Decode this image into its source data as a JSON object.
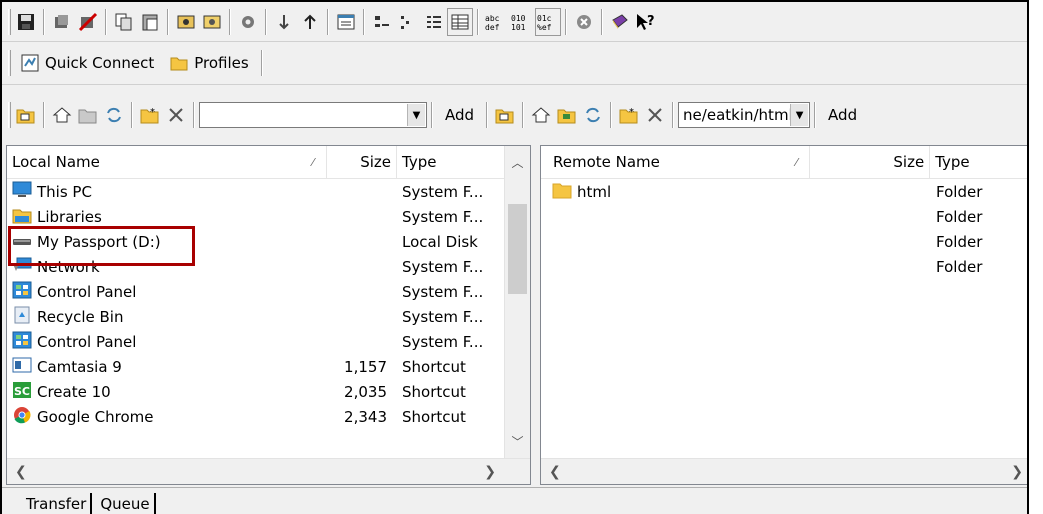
{
  "toolbar2": {
    "quick_connect_label": "Quick Connect",
    "profiles_label": "Profiles"
  },
  "local_bar": {
    "path_value": "",
    "add_label": "Add"
  },
  "remote_bar": {
    "path_value": "ne/eatkin/html",
    "add_label": "Add"
  },
  "local": {
    "headers": {
      "name": "Local Name",
      "size": "Size",
      "type": "Type"
    },
    "rows": [
      {
        "name": "This PC",
        "size": "",
        "type": "System F...",
        "icon": "pc-icon"
      },
      {
        "name": "Libraries",
        "size": "",
        "type": "System F...",
        "icon": "libraries-icon"
      },
      {
        "name": "My Passport (D:)",
        "size": "",
        "type": "Local Disk",
        "icon": "drive-icon"
      },
      {
        "name": "Network",
        "size": "",
        "type": "System F...",
        "icon": "network-icon"
      },
      {
        "name": "Control Panel",
        "size": "",
        "type": "System F...",
        "icon": "control-panel-icon"
      },
      {
        "name": "Recycle Bin",
        "size": "",
        "type": "System F...",
        "icon": "recycle-bin-icon"
      },
      {
        "name": "Control Panel",
        "size": "",
        "type": "System F...",
        "icon": "control-panel-icon"
      },
      {
        "name": "Camtasia 9",
        "size": "1,157",
        "type": "Shortcut",
        "icon": "camtasia-icon"
      },
      {
        "name": "Create 10",
        "size": "2,035",
        "type": "Shortcut",
        "icon": "create-icon"
      },
      {
        "name": "Google Chrome",
        "size": "2,343",
        "type": "Shortcut",
        "icon": "chrome-icon"
      }
    ]
  },
  "remote": {
    "headers": {
      "name": "Remote Name",
      "size": "Size",
      "type": "Type"
    },
    "rows": [
      {
        "name": "html",
        "size": "",
        "type": "Folder",
        "icon": "folder-icon"
      },
      {
        "name": "",
        "size": "",
        "type": "Folder",
        "icon": ""
      },
      {
        "name": "",
        "size": "",
        "type": "Folder",
        "icon": ""
      },
      {
        "name": "",
        "size": "",
        "type": "Folder",
        "icon": ""
      }
    ]
  },
  "tabs": [
    {
      "label": "Transfer"
    },
    {
      "label": "Queue"
    }
  ],
  "colors": {
    "highlight_box": "#a80000",
    "folder": "#f5c542",
    "selection_accent": "#3c7fb1"
  }
}
